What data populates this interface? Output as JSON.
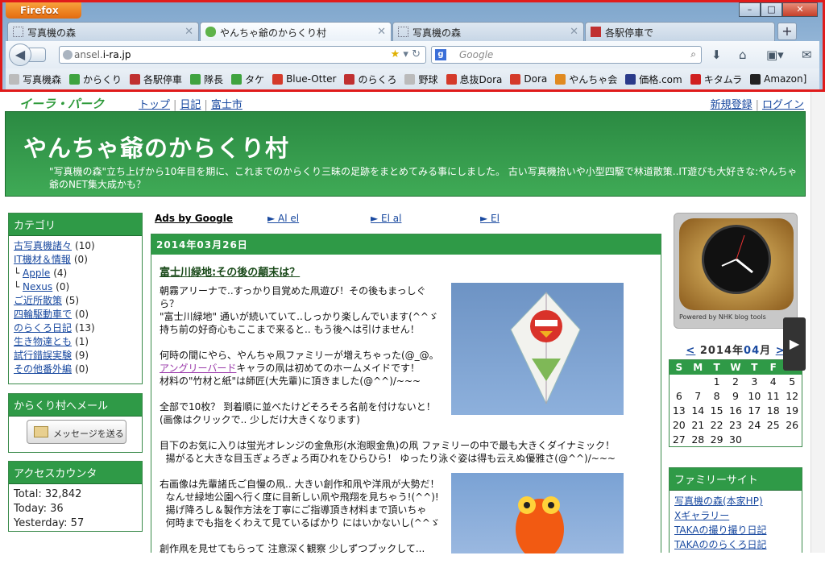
{
  "browser": {
    "app_button": "Firefox",
    "window_controls": {
      "minimize": "–",
      "maximize": "□",
      "close": "✕"
    },
    "tabs": [
      {
        "label": "写真機の森",
        "icon": "page-icon",
        "active": false
      },
      {
        "label": "やんちゃ爺のからくり村",
        "icon": "irapark-icon",
        "active": true
      },
      {
        "label": "写真機の森",
        "icon": "page-icon",
        "active": false
      },
      {
        "label": "各駅停車で",
        "icon": "goo-icon",
        "active": false
      }
    ],
    "new_tab": "+",
    "url": {
      "prefix": "ansel.",
      "domain": "i-ra.jp"
    },
    "search_placeholder": "Google",
    "bookmarks": [
      {
        "label": "写真機森",
        "color": "#bbbbbb"
      },
      {
        "label": "からくり",
        "color": "#3fa33f"
      },
      {
        "label": "各駅停車",
        "color": "#c03030"
      },
      {
        "label": "隊長",
        "color": "#3fa33f"
      },
      {
        "label": "タケ",
        "color": "#3fa33f"
      },
      {
        "label": "Blue-Otter",
        "color": "#d43a2a"
      },
      {
        "label": "のらくろ",
        "color": "#c03030"
      },
      {
        "label": "野球",
        "color": "#bbbbbb"
      },
      {
        "label": "息抜Dora",
        "color": "#d43a2a"
      },
      {
        "label": "Dora",
        "color": "#d43a2a"
      },
      {
        "label": "やんちゃ会",
        "color": "#e08a20"
      },
      {
        "label": "価格.com",
        "color": "#2a3a8a"
      },
      {
        "label": "キタムラ",
        "color": "#d02020"
      },
      {
        "label": "Amazon]",
        "color": "#222222"
      }
    ]
  },
  "site": {
    "logo": "イーラ・パーク",
    "nav": [
      "トップ",
      "日記",
      "富士市"
    ],
    "account": [
      "新規登録",
      "ログイン"
    ],
    "title": "やんちゃ爺のからくり村",
    "description": "\"写真機の森\"立ち上げから10年目を期に、これまでのからくり三昧の足跡をまとめてみる事にしました。 古い写真機拾いや小型四駆で林道散策..IT遊びも大好きな:やんちゃ爺のNET集大成かも？"
  },
  "sidebar": {
    "category_title": "カテゴリ",
    "categories": [
      {
        "prefix": "",
        "label": "古写真機諸々",
        "count": "(10)"
      },
      {
        "prefix": "",
        "label": "IT機材＆情報",
        "count": "(0)"
      },
      {
        "prefix": "└ ",
        "label": "Apple",
        "count": "(4)"
      },
      {
        "prefix": "└ ",
        "label": "Nexus",
        "count": "(0)"
      },
      {
        "prefix": "",
        "label": "ご近所散策",
        "count": "(5)"
      },
      {
        "prefix": "",
        "label": "四輪駆動車で",
        "count": "(0)"
      },
      {
        "prefix": "",
        "label": "のらくろ日記",
        "count": "(13)"
      },
      {
        "prefix": "",
        "label": "生き物達とも",
        "count": "(1)"
      },
      {
        "prefix": "",
        "label": "試行錯誤実験",
        "count": "(9)"
      },
      {
        "prefix": "",
        "label": "その他番外編",
        "count": "(0)"
      }
    ],
    "mail_title": "からくり村へメール",
    "mail_button": "メッセージを送る",
    "counter_title": "アクセスカウンタ",
    "counter": {
      "total": "Total: 32,842",
      "today": "Today: 36",
      "yesterday": "Yesterday: 57"
    }
  },
  "main": {
    "ads_label": "Ads by Google",
    "ads": [
      "► Al el",
      "► El al",
      "► El"
    ],
    "date": "2014年03月26日",
    "entry_title": "富士川緑地:その後の顛末は？",
    "paragraphs": [
      [
        "朝霧アリーナで..すっかり目覚めた凧遊び！その後もまっしぐら？",
        "\"富士川緑地\" 通いが続いていて..しっかり楽しんでいます(^^ゞ",
        "持ち前の好奇心もここまで来ると.. もう後へは引けません！"
      ],
      [
        "何時の間にやら、やんちゃ凧ファミリーが増えちゃった(@_@。"
      ],
      [
        "キャラの凧は初めてのホームメイドです！",
        "材料の\"竹材と紙\"は師匠(大先輩)に頂きました(@^^)/~~~"
      ],
      [
        "全部で10枚？ 到着順に並べたけどそろそろ名前を付けないと！",
        "(画像はクリックで.. 少しだけ大きくなります)"
      ],
      [
        "目下のお気に入りは蛍光オレンジの金魚形(水泡眼金魚)の凧 ファミリーの中で最も大きくダイナミック！",
        "揚がると大きな目玉ぎょろぎょろ両ひれをひらひら！ ゆったり泳ぐ姿は得も云えぬ優雅さ(@^^)/~~~"
      ],
      [
        "右画像は先輩諸氏ご自慢の凧.. 大きい創作和凧や洋凧が大勢だ！",
        "なんせ緑地公園へ行く度に目新しい凧や飛翔を見ちゃう!(^^)!",
        "揚げ降ろし＆製作方法を丁寧にご指導頂き材料まで頂いちゃ",
        "何時までも指をくわえて見ているばかり にはいかないし(^^ゞ"
      ],
      [
        "創作凧を見せてもらって 注意深く観察 少しずつブックして..."
      ]
    ],
    "angry_link": "アングリーバード"
  },
  "right": {
    "clock_credit": "Powered by NHK blog tools",
    "calendar": {
      "prev": "<",
      "year": "2014",
      "year_suffix": "年",
      "month": "04",
      "month_suffix": "月",
      "next": ">",
      "weekdays": [
        "S",
        "M",
        "T",
        "W",
        "T",
        "F",
        "S"
      ],
      "weeks": [
        [
          "",
          "",
          "1",
          "2",
          "3",
          "4",
          "5"
        ],
        [
          "6",
          "7",
          "8",
          "9",
          "10",
          "11",
          "12"
        ],
        [
          "13",
          "14",
          "15",
          "16",
          "17",
          "18",
          "19"
        ],
        [
          "20",
          "21",
          "22",
          "23",
          "24",
          "25",
          "26"
        ],
        [
          "27",
          "28",
          "29",
          "30",
          "",
          "",
          ""
        ]
      ]
    },
    "family_title": "ファミリーサイト",
    "family_links": [
      "写真機の森(本家HP)",
      "Xギャラリー",
      "TAKAの撮り撮り日記",
      "TAKAののらくろ日記"
    ]
  }
}
